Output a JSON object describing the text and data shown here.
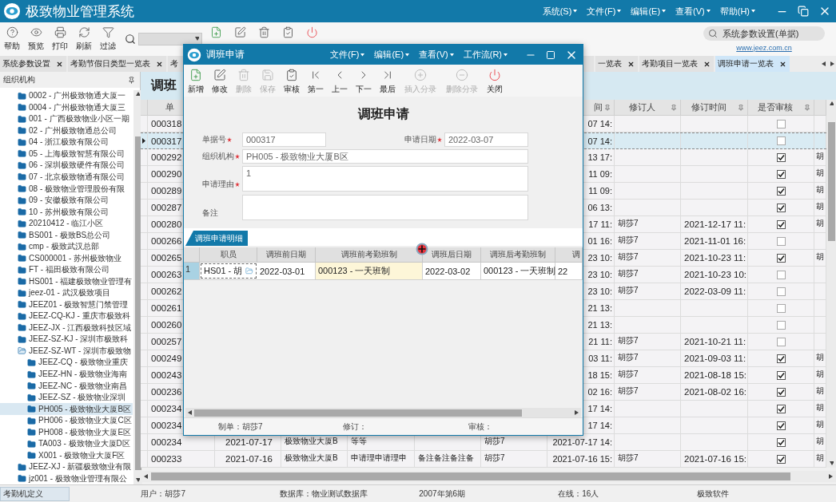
{
  "window": {
    "title": "极致物业管理系统",
    "menus": [
      "系统(S)",
      "文件(F)",
      "编辑(E)",
      "查看(V)",
      "帮助(H)"
    ]
  },
  "toolbar": {
    "buttons": [
      {
        "label": "帮助",
        "kind": "help"
      },
      {
        "label": "预览",
        "kind": "preview"
      },
      {
        "label": "打印",
        "kind": "print"
      },
      {
        "label": "刷新",
        "kind": "refresh"
      },
      {
        "label": "过滤",
        "kind": "filter"
      }
    ],
    "icon_buttons": [
      {
        "kind": "add"
      },
      {
        "kind": "edit"
      },
      {
        "kind": "delete"
      },
      {
        "kind": "audit"
      },
      {
        "kind": "close"
      }
    ],
    "search_pill": "系统参数设置(单据)",
    "link": "www.jeez.com.cn"
  },
  "tabs": [
    {
      "label": "系统参数设置",
      "selected": false,
      "close": true
    },
    {
      "label": "考勤节假日类型一览表",
      "selected": false,
      "close": true
    },
    {
      "label": "考",
      "selected": false,
      "close": false
    },
    {
      "label": "一览表",
      "selected": false,
      "close": true
    },
    {
      "label": "考勤项目一览表",
      "selected": false,
      "close": true
    },
    {
      "label": "调班申请一览表",
      "selected": true,
      "close": true
    }
  ],
  "org_panel": {
    "header": "组织机构",
    "items": [
      {
        "label": "0002 - 广州极致物通大厦一",
        "selected": false
      },
      {
        "label": "0004 - 广州极致物通大厦三",
        "selected": false
      },
      {
        "label": "001 - 广西极致物业小区一期",
        "selected": false
      },
      {
        "label": "02 - 广州极致物通总公司",
        "selected": false
      },
      {
        "label": "04 - 浙江极致有限公司",
        "selected": false
      },
      {
        "label": "05 - 上海极致智慧有限公司",
        "selected": false
      },
      {
        "label": "06 - 深圳极致硬件有限公司",
        "selected": false
      },
      {
        "label": "07 - 北京极致物通有限公司",
        "selected": false
      },
      {
        "label": "08 - 极致物业管理股份有限",
        "selected": false
      },
      {
        "label": "09 - 安徽极致有限公司",
        "selected": false
      },
      {
        "label": "10 - 苏州极致有限公司",
        "selected": false
      },
      {
        "label": "20210412 - 临江小区",
        "selected": false
      },
      {
        "label": "BS001 - 极致BS总公司",
        "selected": false
      },
      {
        "label": "cmp - 极致武汉总部",
        "selected": false
      },
      {
        "label": "CS000001 - 苏州极致物业",
        "selected": false
      },
      {
        "label": "FT - 福田极致有限公司",
        "selected": false
      },
      {
        "label": "HS001 - 福建极致物业管理有",
        "selected": false
      },
      {
        "label": "jeez-01 - 武汉极致项目",
        "selected": false
      },
      {
        "label": "JEEZ01 - 极致智慧门禁管理",
        "selected": false
      },
      {
        "label": "JEEZ-CQ-KJ - 重庆市极致科",
        "selected": false
      },
      {
        "label": "JEEZ-JX - 江西极致科技区域",
        "selected": false
      },
      {
        "label": "JEEZ-SZ-KJ - 深圳市极致科",
        "selected": false
      },
      {
        "label": "JEEZ-SZ-WT - 深圳市极致物",
        "selected": false,
        "expanded": true,
        "children": [
          {
            "label": "JEEZ-CQ - 极致物业重庆",
            "selected": false
          },
          {
            "label": "JEEZ-HN - 极致物业海南",
            "selected": false
          },
          {
            "label": "JEEZ-NC - 极致物业南昌",
            "selected": false
          },
          {
            "label": "JEEZ-SZ - 极致物业深圳",
            "selected": false
          },
          {
            "label": "PH005 - 极致物业大厦B区",
            "selected": true
          },
          {
            "label": "PH006 - 极致物业大厦C区",
            "selected": false
          },
          {
            "label": "PH008 - 极致物业大厦E区",
            "selected": false
          },
          {
            "label": "TA003 - 极致物业大厦D区",
            "selected": false
          },
          {
            "label": "X001 - 极致物业大厦F区",
            "selected": false
          }
        ]
      },
      {
        "label": "JEEZ-XJ - 新疆极致物业有限",
        "selected": false
      },
      {
        "label": "jz001 - 极致物业管理有限公",
        "selected": false
      }
    ]
  },
  "main_list": {
    "title": "调班",
    "header": {
      "id": "单",
      "made_time": "间",
      "reviser": "修订人",
      "revise_time": "修订时间",
      "audited": "是否审核"
    },
    "rows": [
      {
        "id": "000318",
        "made_time": "07 14:",
        "audited": false,
        "selected": false
      },
      {
        "id": "000317",
        "made_time": "07 14:",
        "audited": false,
        "selected": true
      },
      {
        "id": "000292",
        "made_time": "13 17:",
        "audited": true,
        "auditor": "胡",
        "selected": false
      },
      {
        "id": "000290",
        "made_time": "11 09:",
        "audited": true,
        "auditor": "胡",
        "selected": false
      },
      {
        "id": "000289",
        "made_time": "11 09:",
        "audited": true,
        "auditor": "胡",
        "selected": false
      },
      {
        "id": "000287",
        "made_time": "06 13:",
        "audited": true,
        "auditor": "胡",
        "selected": false
      },
      {
        "id": "000280",
        "made_time": "17 11:",
        "reviser": "胡莎7",
        "revise_time": "2021-12-17 11:",
        "audited": true,
        "auditor": "胡",
        "selected": false
      },
      {
        "id": "000266",
        "made_time": "01 16:",
        "reviser": "胡莎7",
        "revise_time": "2021-11-01 16:",
        "audited": false,
        "selected": false
      },
      {
        "id": "000265",
        "made_time": "23 10:",
        "reviser": "胡莎7",
        "revise_time": "2021-10-23 11:",
        "audited": true,
        "auditor": "胡",
        "selected": false
      },
      {
        "id": "000263",
        "made_time": "23 10:",
        "reviser": "胡莎7",
        "revise_time": "2021-10-23 10:",
        "audited": false,
        "selected": false
      },
      {
        "id": "000262",
        "made_time": "23 10:",
        "reviser": "胡莎7",
        "revise_time": "2022-03-09 11:",
        "audited": false,
        "selected": false
      },
      {
        "id": "000261",
        "made_time": "21 13:",
        "audited": false,
        "selected": false
      },
      {
        "id": "000260",
        "made_time": "21 13:",
        "audited": false,
        "selected": false
      },
      {
        "id": "000257",
        "made_time": "21 11:",
        "reviser": "胡莎7",
        "revise_time": "2021-10-21 11:",
        "audited": false,
        "selected": false
      },
      {
        "id": "000249",
        "made_time": "03 11:",
        "reviser": "胡莎7",
        "revise_time": "2021-09-03 11:",
        "audited": true,
        "auditor": "胡",
        "selected": false
      },
      {
        "id": "000243",
        "made_time": "18 15:",
        "reviser": "胡莎7",
        "revise_time": "2021-08-18 15:",
        "audited": true,
        "auditor": "胡",
        "selected": false
      },
      {
        "id": "000236",
        "made_time": "02 16:",
        "reviser": "胡莎7",
        "revise_time": "2021-08-02 16:",
        "audited": true,
        "auditor": "胡",
        "selected": false
      },
      {
        "id": "000234",
        "made_time": "17 14:",
        "audited": true,
        "auditor": "胡",
        "selected": false
      },
      {
        "id": "000234",
        "made_time": "17 14:",
        "audited": true,
        "auditor": "胡",
        "selected": false
      },
      {
        "id": "000234",
        "date": "2021-07-17",
        "org": "极致物业大厦B",
        "reason": "等等",
        "maker": "胡莎7",
        "made_time": "2021-07-17 14:",
        "audited": true,
        "auditor": "胡",
        "selected": false
      },
      {
        "id": "000233",
        "date": "2021-07-16",
        "org": "极致物业大厦B",
        "reason": "申请理申请理申",
        "note": "备注备注备注备",
        "maker": "胡莎7",
        "made_time": "2021-07-16 15:",
        "reviser": "胡莎7",
        "revise_time": "2021-07-16 15:",
        "audited": true,
        "auditor": "胡",
        "selected": false
      }
    ]
  },
  "dialog": {
    "title": "调班申请",
    "menus": [
      "文件(F)",
      "编辑(E)",
      "查看(V)",
      "工作流(R)"
    ],
    "toolbar": [
      {
        "label": "新增",
        "kind": "add",
        "disabled": false
      },
      {
        "label": "修改",
        "kind": "edit",
        "disabled": false
      },
      {
        "label": "删除",
        "kind": "delete",
        "disabled": true
      },
      {
        "label": "保存",
        "kind": "save",
        "disabled": true
      },
      {
        "label": "审核",
        "kind": "audit",
        "disabled": false
      },
      {
        "label": "第一",
        "kind": "first",
        "disabled": false
      },
      {
        "label": "上一",
        "kind": "prev",
        "disabled": false
      },
      {
        "label": "下一",
        "kind": "next",
        "disabled": false
      },
      {
        "label": "最后",
        "kind": "last",
        "disabled": false
      },
      {
        "label": "插入分录",
        "kind": "insert",
        "disabled": true
      },
      {
        "label": "删除分录",
        "kind": "remove",
        "disabled": true
      },
      {
        "label": "关闭",
        "kind": "close",
        "disabled": false
      }
    ],
    "form_title": "调班申请",
    "fields": [
      {
        "label": "单据号",
        "value": "000317",
        "required": true,
        "kind": "short"
      },
      {
        "label": "申请日期",
        "value": "2022-03-07",
        "required": true,
        "kind": "short"
      },
      {
        "label": "组织机构",
        "value": "PH005 - 极致物业大厦B区",
        "required": true,
        "kind": "wide"
      },
      {
        "label": "申请理由",
        "value": "1",
        "required": true,
        "kind": "area"
      },
      {
        "label": "备注",
        "required": false,
        "kind": "area"
      }
    ],
    "detail_tab": "调班申请明细",
    "grid": {
      "columns": [
        "职员",
        "调班前日期",
        "调班前考勤班制",
        "调班后日期",
        "调班后考勤班制",
        "调"
      ],
      "rows": [
        {
          "number": "1",
          "selected": true,
          "cells": [
            {
              "text": "HS01 - 胡",
              "kind": "lookup",
              "highlighted": false
            },
            {
              "text": "2022-03-01",
              "kind": "text",
              "highlighted": false
            },
            {
              "text": "000123 - 一天班制",
              "kind": "text",
              "highlighted": true
            },
            {
              "text": "2022-03-02",
              "kind": "text",
              "highlighted": false
            },
            {
              "text": "000123 - 一天班制",
              "kind": "text",
              "highlighted": false
            },
            {
              "text": "22",
              "kind": "text",
              "highlighted": false
            }
          ]
        }
      ]
    },
    "footer": [
      "制单：胡莎7",
      "修订：",
      "审核："
    ]
  },
  "status_bar": {
    "tab": "考勤机定义",
    "items": [
      "用户：胡莎7",
      "数据库：物业测试数据库",
      "2007年第6期",
      "在线：16人",
      "极致软件"
    ]
  }
}
